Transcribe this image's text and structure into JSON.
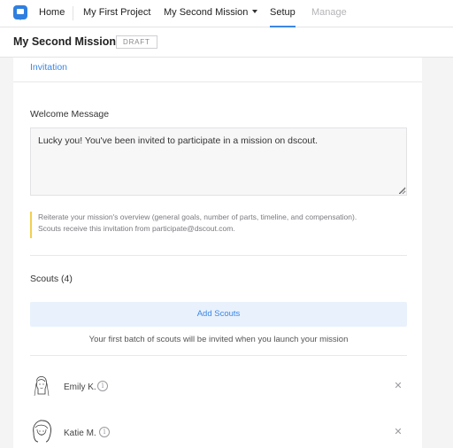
{
  "nav": {
    "home": "Home",
    "project": "My First Project",
    "mission": "My Second Mission",
    "setup": "Setup",
    "manage": "Manage"
  },
  "header": {
    "title": "My Second Mission",
    "badge": "DRAFT"
  },
  "invitation": {
    "link": "Invitation"
  },
  "welcome": {
    "label": "Welcome Message",
    "value": "Lucky you! You've been invited to participate in a mission on dscout.",
    "hint_line1": "Reiterate your mission's overview (general goals, number of parts, timeline, and compensation).",
    "hint_line2": "Scouts receive this invitation from participate@dscout.com."
  },
  "scouts": {
    "label": "Scouts (4)",
    "add_button": "Add Scouts",
    "note": "Your first batch of scouts will be invited when you launch your mission",
    "list": [
      {
        "name": "Emily K."
      },
      {
        "name": "Katie M."
      }
    ]
  },
  "colors": {
    "accent": "#3b86e6",
    "hint_bar": "#f2cf4f",
    "add_bg": "#e8f1fc"
  }
}
